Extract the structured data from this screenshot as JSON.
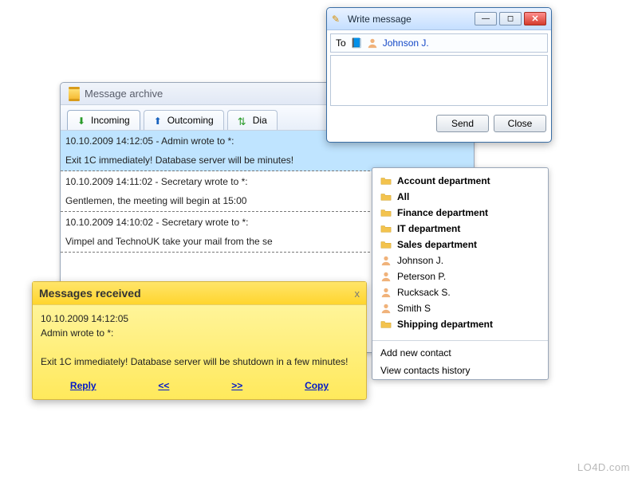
{
  "archive": {
    "title": "Message archive",
    "tabs": {
      "incoming": "Incoming",
      "outcoming": "Outcoming",
      "dial": "Dia"
    },
    "messages": [
      {
        "meta": "10.10.2009 14:12:05 - Admin wrote to *:",
        "text": "Exit 1C immediately! Database server will be                         minutes!"
      },
      {
        "meta": "10.10.2009 14:11:02 - Secretary wrote to *:",
        "text": "Gentlemen, the meeting will begin at 15:00"
      },
      {
        "meta": "10.10.2009 14:10:02 - Secretary wrote to *:",
        "text": "Vimpel and TechnoUK take your mail from the se"
      }
    ]
  },
  "write": {
    "title": "Write message",
    "to_label": "To",
    "recipient": "Johnson J.",
    "buttons": {
      "send": "Send",
      "close": "Close"
    }
  },
  "contacts": {
    "items": [
      {
        "label": "Account department",
        "type": "folder"
      },
      {
        "label": "All",
        "type": "folder"
      },
      {
        "label": "Finance department",
        "type": "folder"
      },
      {
        "label": "IT department",
        "type": "folder"
      },
      {
        "label": "Sales department",
        "type": "folder"
      },
      {
        "label": "Johnson J.",
        "type": "user"
      },
      {
        "label": "Peterson P.",
        "type": "user"
      },
      {
        "label": "Rucksack S.",
        "type": "user"
      },
      {
        "label": "Smith S",
        "type": "user"
      },
      {
        "label": "Shipping department",
        "type": "folder"
      }
    ],
    "menu": {
      "add": "Add new contact",
      "history": "View contacts history"
    }
  },
  "notify": {
    "title": "Messages received",
    "meta1": "10.10.2009 14:12:05",
    "meta2": "Admin wrote to *:",
    "body": "Exit 1C immediately! Database server will be shutdown in a few minutes!",
    "links": {
      "reply": "Reply",
      "prev": "<<",
      "next": ">>",
      "copy": "Copy"
    }
  },
  "watermark": "LO4D.com"
}
